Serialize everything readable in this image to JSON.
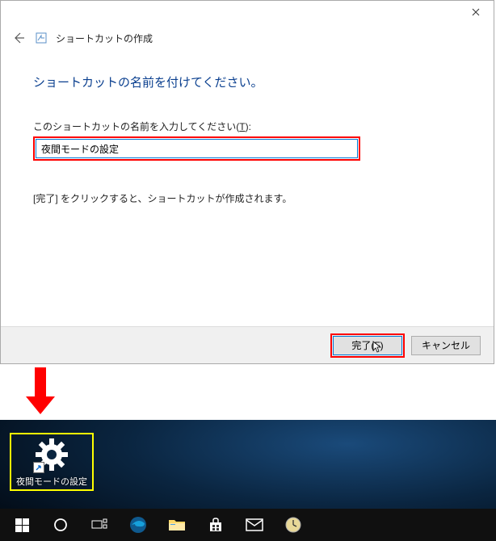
{
  "dialog": {
    "window_title": "ショートカットの作成",
    "heading": "ショートカットの名前を付けてください。",
    "label_prefix": "このショートカットの名前を入力してください(",
    "label_accel": "T",
    "label_suffix": "):",
    "input_value": "夜間モードの設定",
    "hint": "[完了] をクリックすると、ショートカットが作成されます。",
    "finish_btn": "完了(F)",
    "cancel_btn": "キャンセル"
  },
  "desktop": {
    "shortcut_label": "夜間モードの設定"
  }
}
